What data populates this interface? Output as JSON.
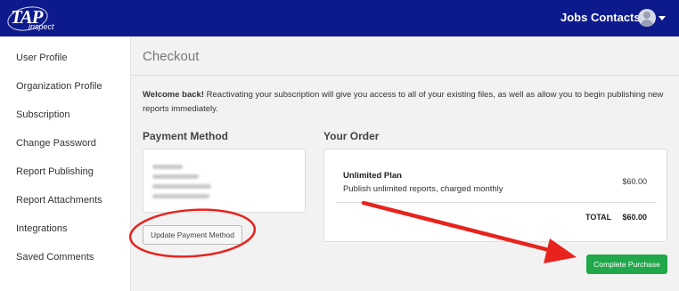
{
  "navbar": {
    "logo_text": "TAP",
    "logo_sub": "inspect",
    "links": [
      "Jobs",
      "Contacts"
    ],
    "avatar_icon": "user-avatar-icon",
    "caret_icon": "chevron-down-icon",
    "bg_color": "#0d1a8c"
  },
  "sidebar": {
    "items": [
      {
        "label": "User Profile"
      },
      {
        "label": "Organization Profile"
      },
      {
        "label": "Subscription"
      },
      {
        "label": "Change Password"
      },
      {
        "label": "Report Publishing"
      },
      {
        "label": "Report Attachments"
      },
      {
        "label": "Integrations"
      },
      {
        "label": "Saved Comments"
      }
    ]
  },
  "main": {
    "title": "Checkout",
    "welcome_bold": "Welcome back!",
    "welcome_text": " Reactivating your subscription will give you access to all of your existing files, as well as allow you to begin publishing new reports immediately.",
    "payment": {
      "heading": "Payment Method",
      "update_button": "Update Payment Method"
    },
    "order": {
      "heading": "Your Order",
      "plan_name": "Unlimited Plan",
      "plan_desc": "Publish unlimited reports, charged monthly",
      "plan_price": "$60.00",
      "total_label": "TOTAL",
      "total_value": "$60.00"
    },
    "complete_button": "Complete Purchase",
    "accent_color": "#20a84a",
    "annotation_color": "#e8231d"
  }
}
